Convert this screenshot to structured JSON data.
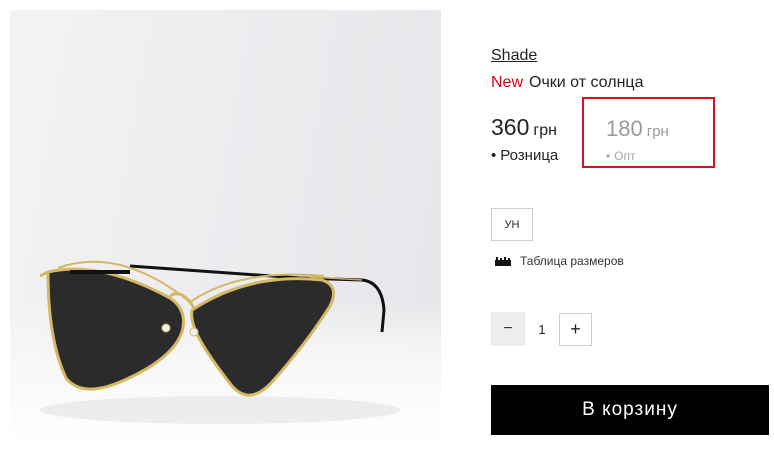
{
  "product": {
    "brand": "Shade",
    "badge": "New",
    "title": "Очки от солнца",
    "image_alt_icon": "sunglasses-photo"
  },
  "prices": {
    "retail": {
      "value": "360",
      "currency": "грн",
      "label": "Розница",
      "bullet": "•"
    },
    "wholesale": {
      "value": "180",
      "currency": "грн",
      "label": "Опт",
      "bullet": "•"
    }
  },
  "sizes": {
    "options": [
      "УН"
    ],
    "selected": "УН",
    "size_table_label": "Таблица размеров",
    "size_table_icon": "ruler-icon"
  },
  "quantity": {
    "minus_label": "−",
    "value": "1",
    "plus_label": "+"
  },
  "cart": {
    "button_label": "В корзину"
  },
  "colors": {
    "accent_new": "#d0021b",
    "highlight_border": "#d6141f",
    "cart_bg": "#000000",
    "muted_price": "#9a9a9a"
  }
}
